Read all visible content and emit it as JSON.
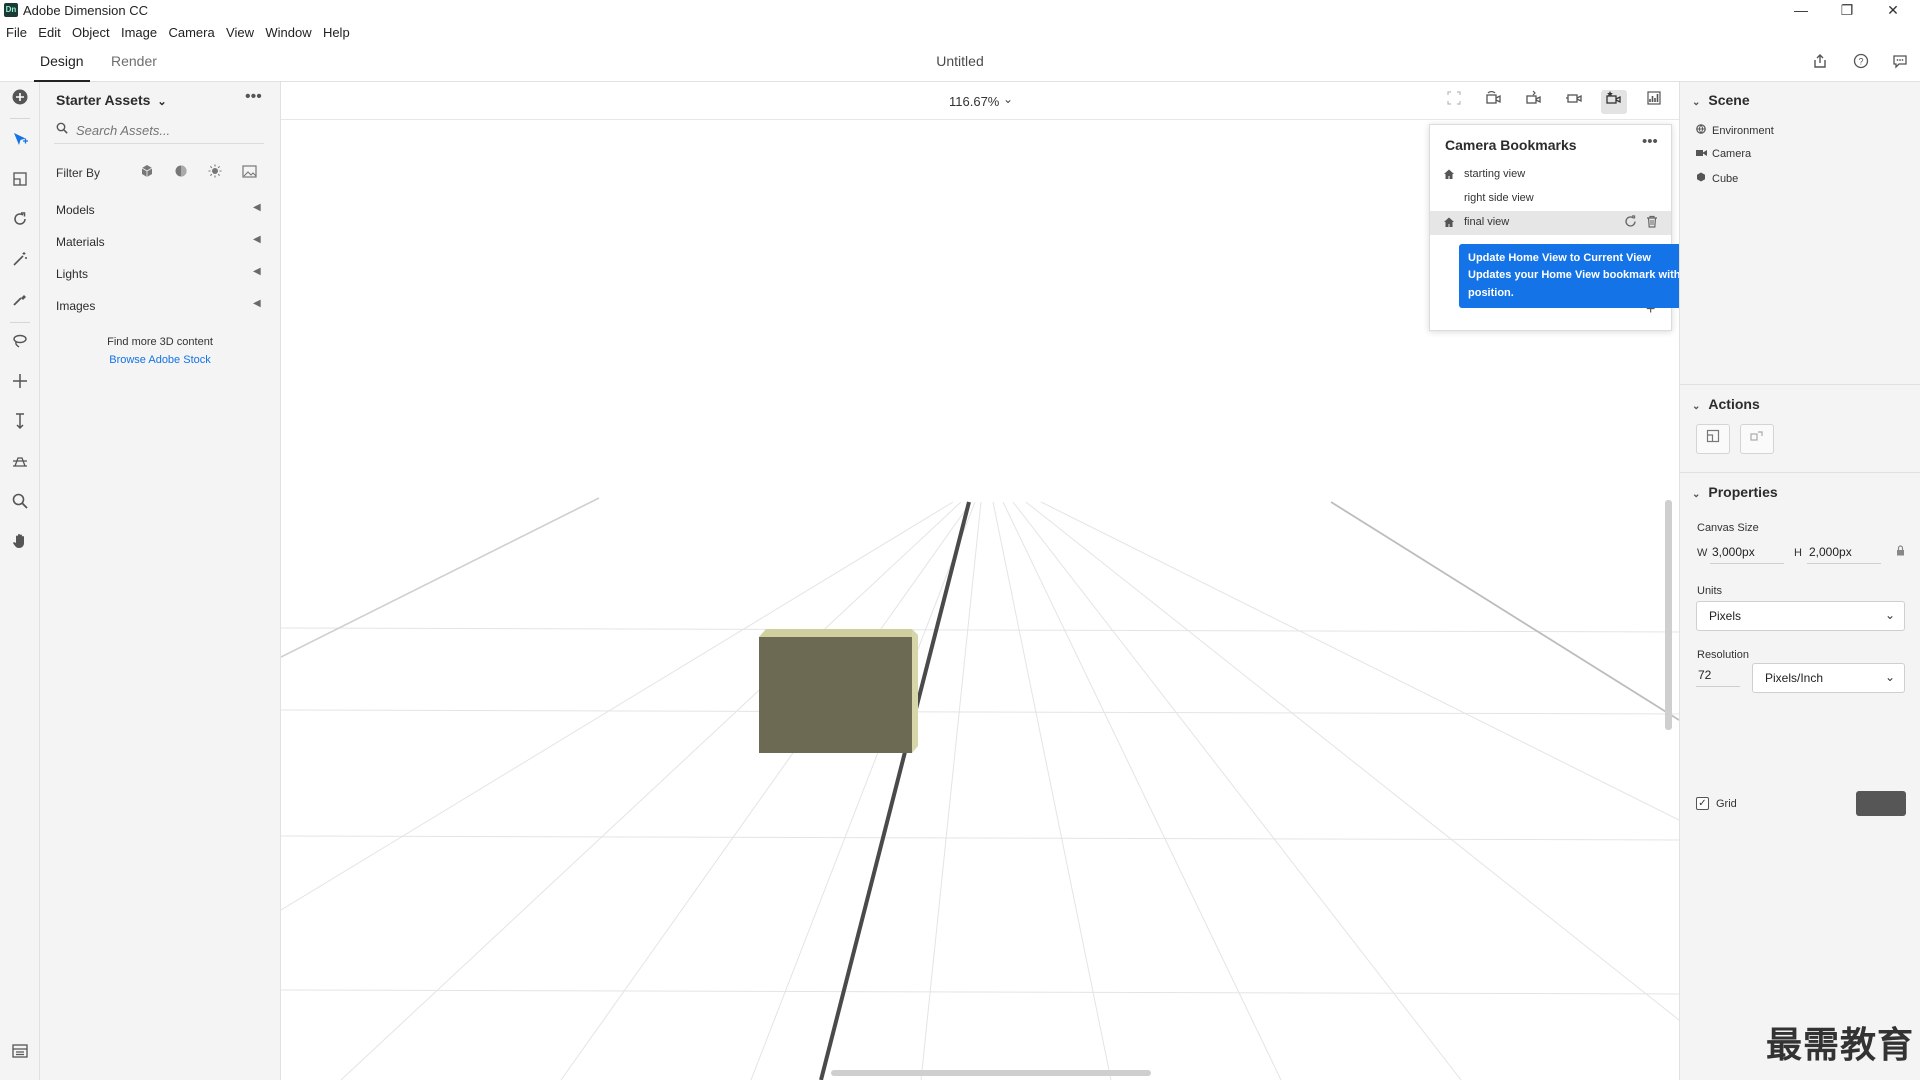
{
  "window": {
    "app_logo": "Dn",
    "title": "Adobe Dimension CC",
    "controls": [
      "—",
      "❐",
      "✕"
    ]
  },
  "menu": [
    "File",
    "Edit",
    "Object",
    "Image",
    "Camera",
    "View",
    "Window",
    "Help"
  ],
  "tabs": {
    "design": "Design",
    "render": "Render",
    "document_title": "Untitled"
  },
  "header_icons": [
    "share-icon",
    "help-icon",
    "feedback-icon"
  ],
  "toolbar": {
    "tools": [
      "add-icon",
      "select-icon",
      "frame-icon",
      "orbit-icon",
      "magic-wand-icon",
      "sample-icon",
      "lasso-icon",
      "pan-icon",
      "dolly-icon",
      "horizon-icon",
      "zoom-icon",
      "hand-icon"
    ],
    "active_tool": "select-icon"
  },
  "assets": {
    "title": "Starter Assets",
    "search_placeholder": "Search Assets...",
    "filter_label": "Filter By",
    "filters": [
      "models-filter-icon",
      "materials-filter-icon",
      "lights-filter-icon",
      "images-filter-icon"
    ],
    "categories": [
      "Models",
      "Materials",
      "Lights",
      "Images"
    ],
    "find_more": "Find more 3D content",
    "browse_link": "Browse Adobe Stock"
  },
  "viewport": {
    "zoom": "116.67%",
    "camera_tools": [
      "frame-selection-icon",
      "orbit-camera-icon",
      "pan-camera-icon",
      "dolly-camera-icon",
      "camera-bookmarks-icon",
      "histogram-icon"
    ],
    "active_camera_tool": "camera-bookmarks-icon",
    "cube_color": "#6c6a52"
  },
  "bookmarks": {
    "title": "Camera Bookmarks",
    "items": [
      {
        "label": "starting view",
        "home": true,
        "selected": false
      },
      {
        "label": "right side view",
        "home": false,
        "selected": false
      },
      {
        "label": "final view",
        "home": true,
        "selected": true
      }
    ],
    "tooltip_title": "Update Home View to Current View",
    "tooltip_body": "Updates your Home View bookmark with your current view position."
  },
  "right_panel": {
    "scene_title": "Scene",
    "scene_items": [
      {
        "label": "Environment",
        "icon": "environment-icon"
      },
      {
        "label": "Camera",
        "icon": "camera-icon"
      },
      {
        "label": "Cube",
        "icon": "cube-icon"
      }
    ],
    "actions_title": "Actions",
    "properties_title": "Properties",
    "canvas_size_label": "Canvas Size",
    "width_prefix": "W",
    "width": "3,000px",
    "height_prefix": "H",
    "height": "2,000px",
    "units_label": "Units",
    "units": "Pixels",
    "resolution_label": "Resolution",
    "resolution": "72",
    "resolution_unit": "Pixels/Inch",
    "grid_label": "Grid",
    "grid_checked": true,
    "grid_color": "#565656"
  },
  "watermark": "最需教育"
}
